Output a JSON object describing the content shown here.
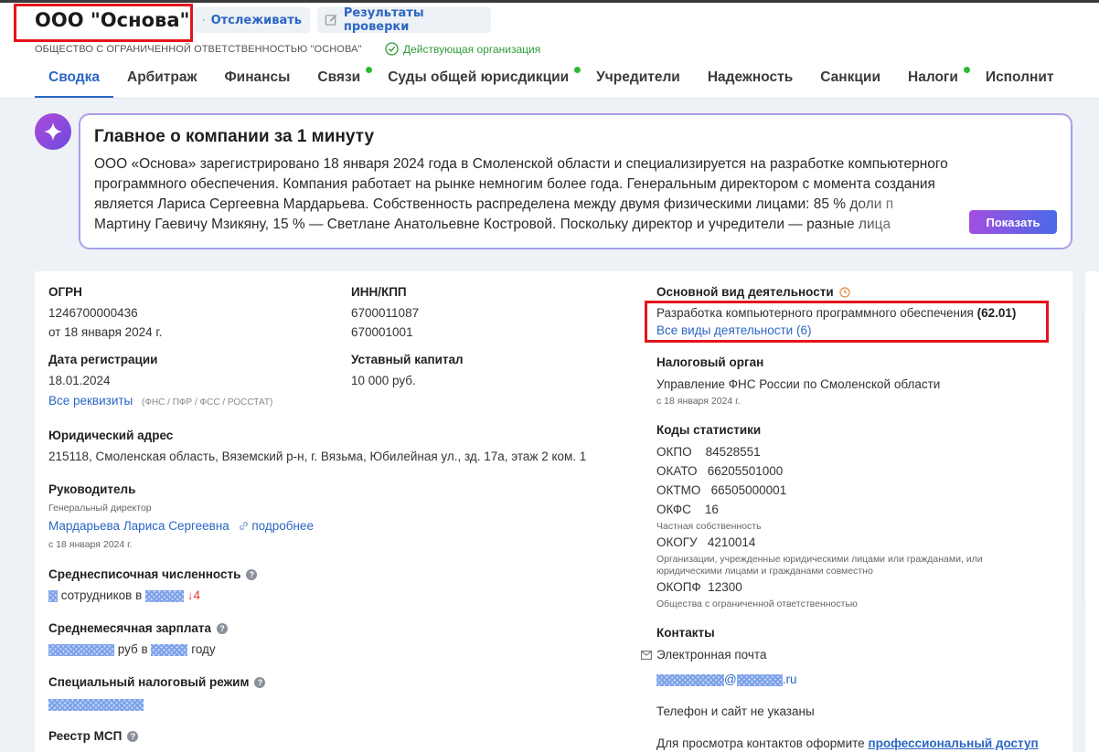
{
  "header": {
    "company_name": "ООО \"Основа\"",
    "track_label": "Отслеживать",
    "check_label": "Результаты проверки",
    "full_name": "ОБЩЕСТВО С ОГРАНИЧЕННОЙ ОТВЕТСТВЕННОСТЬЮ \"ОСНОВА\"",
    "status": "Действующая организация"
  },
  "tabs": [
    {
      "label": "Сводка",
      "active": true,
      "dot": false
    },
    {
      "label": "Арбитраж",
      "dot": false
    },
    {
      "label": "Финансы",
      "dot": false
    },
    {
      "label": "Связи",
      "dot": true
    },
    {
      "label": "Суды общей юрисдикции",
      "dot": true
    },
    {
      "label": "Учредители",
      "dot": false
    },
    {
      "label": "Надежность",
      "dot": false
    },
    {
      "label": "Санкции",
      "dot": false
    },
    {
      "label": "Налоги",
      "dot": true
    },
    {
      "label": "Исполнит",
      "dot": false
    }
  ],
  "summary": {
    "title": "Главное о компании за 1 минуту",
    "line1": "ООО «Основа» зарегистрировано 18 января 2024 года в Смоленской области и специализируется на разработке компьютерного",
    "line2": "программного обеспечения. Компания работает на рынке немногим более года. Генеральным директором с момента создания",
    "line3": "является Лариса Сергеевна Мардарьева. Собственность распределена между двумя физическими лицами: 85 % доли п",
    "line4": "Мартину Гаевичу Мзикяну, 15 % — Светлане Анатольевне Костровой. Поскольку директор и учредители — разные лица",
    "show_label": "Показать"
  },
  "left": {
    "ogrn_label": "ОГРН",
    "ogrn_value": "1246700000436",
    "ogrn_date": "от 18 января 2024 г.",
    "reg_label": "Дата регистрации",
    "reg_value": "18.01.2024",
    "requisites_link": "Все реквизиты",
    "requisites_note": "(ФНС / ПФР / ФСС / РОССТАТ)",
    "address_label": "Юридический адрес",
    "address_value": "215118, Смоленская область, Вяземский р-н, г. Вязьма, Юбилейная ул., зд. 17а, этаж 2 ком. 1",
    "head_label": "Руководитель",
    "head_role": "Генеральный директор",
    "head_name": "Мардарьева Лариса Сергеевна",
    "head_more": "подробнее",
    "head_since": "с 18 января 2024 г.",
    "staff_label": "Среднесписочная численность",
    "staff_text": "сотрудников в",
    "staff_change": "↓4",
    "salary_label": "Среднемесячная зарплата",
    "salary_text1": "руб в",
    "salary_text2": "году",
    "tax_label": "Специальный налоговый режим",
    "msp_label": "Реестр МСП"
  },
  "middle": {
    "inn_label": "ИНН/КПП",
    "inn_value": "6700011087",
    "kpp_value": "670001001",
    "capital_label": "Уставный капитал",
    "capital_value": "10 000 руб."
  },
  "right": {
    "activity_label": "Основной вид деятельности",
    "activity_value": "Разработка компьютерного программного обеспечения",
    "activity_code": "(62.01)",
    "activity_all": "Все виды деятельности (6)",
    "tax_office_label": "Налоговый орган",
    "tax_office_value": "Управление ФНС России по Смоленской области",
    "tax_office_since": "с 18 января 2024 г.",
    "stats_label": "Коды статистики",
    "okpo": "ОКПО    84528551",
    "okato": "ОКАТО   66205501000",
    "oktmo": "ОКТМО   66505000001",
    "okfs": "ОКФС    16",
    "okfs_note": "Частная собственность",
    "okogu": "ОКОГУ   4210014",
    "okogu_note1": "Организации, учрежденные юридическими лицами или гражданами, или",
    "okogu_note2": "юридическими лицами и гражданами совместно",
    "okopf": "ОКОПФ  12300",
    "okopf_note": "Общества с ограниченной ответственностью",
    "contacts_label": "Контакты",
    "email_label": "Электронная почта",
    "email_at": "@",
    "email_tld": ".ru",
    "phone_text": "Телефон и сайт не указаны",
    "pro_text": "Для просмотра контактов оформите",
    "pro_link": "профессиональный доступ"
  }
}
